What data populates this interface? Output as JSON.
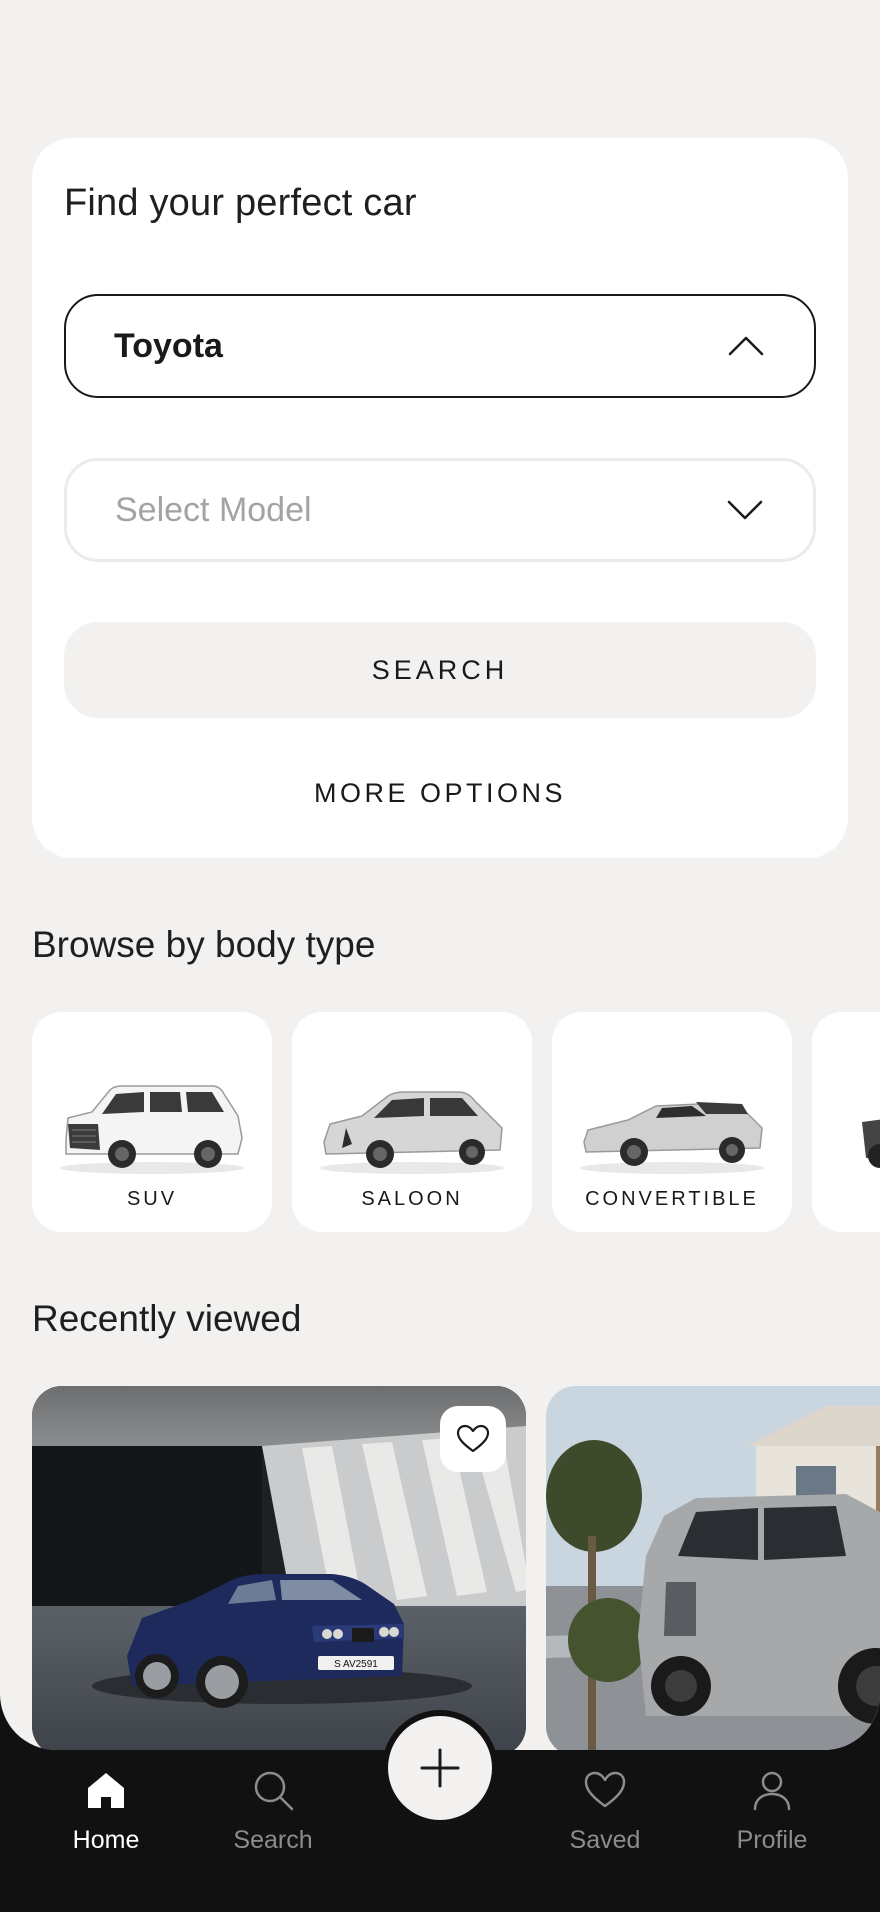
{
  "search_card": {
    "title": "Find your perfect car",
    "make_select": {
      "value": "Toyota",
      "open": true
    },
    "model_select": {
      "placeholder": "Select Model"
    },
    "search_button": "SEARCH",
    "more_options": "MORE OPTIONS"
  },
  "browse": {
    "title": "Browse by body type",
    "types": [
      {
        "label": "SUV",
        "icon": "suv-car-image"
      },
      {
        "label": "SALOON",
        "icon": "saloon-car-image"
      },
      {
        "label": "CONVERTIBLE",
        "icon": "convertible-car-image"
      },
      {
        "label": "",
        "icon": "pickup-car-image"
      }
    ]
  },
  "recent": {
    "title": "Recently viewed",
    "items": [
      {
        "image": "blue-bmw-coupe-photo",
        "plate": "S AV2591",
        "favorite_icon": "heart-icon"
      },
      {
        "image": "grey-suv-photo"
      }
    ]
  },
  "fab": {
    "icon": "plus-icon"
  },
  "tabbar": {
    "tabs": [
      {
        "label": "Home",
        "icon": "home-icon",
        "active": true
      },
      {
        "label": "Search",
        "icon": "search-icon",
        "active": false
      },
      {
        "label": "Saved",
        "icon": "heart-icon",
        "active": false
      },
      {
        "label": "Profile",
        "icon": "profile-icon",
        "active": false
      }
    ]
  },
  "colors": {
    "background": "#f2f1ef",
    "card": "#ffffff",
    "tabbar": "#121111",
    "text": "#1a1a1a",
    "muted": "#a3a3a3",
    "tab_inactive": "#8c8c8c"
  }
}
